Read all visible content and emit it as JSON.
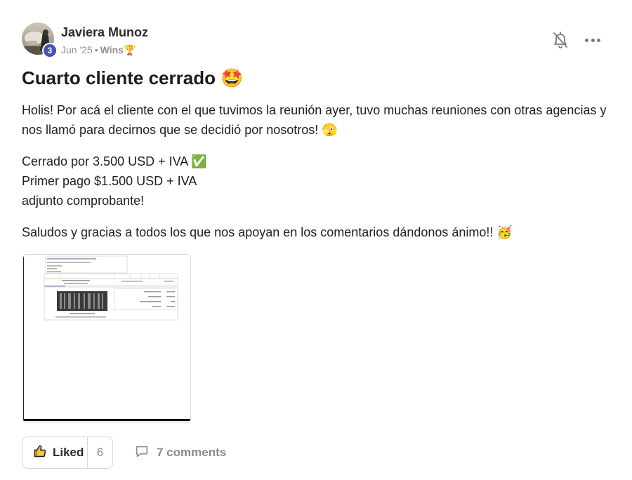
{
  "post": {
    "author": "Javiera Munoz",
    "level": "3",
    "date": "Jun '25",
    "separator": "•",
    "category": "Wins🏆",
    "title": "Cuarto cliente cerrado 🤩",
    "paragraphs": {
      "p1": "Holis! Por acá el cliente con el que tuvimos la reunión ayer, tuvo muchas reuniones con otras agencias y nos llamó para decirnos que se decidió por nosotros! 🫣",
      "p2_line1": "Cerrado por 3.500 USD + IVA ✅",
      "p2_line2": "Primer pago $1.500 USD + IVA",
      "p2_line3": "adjunto comprobante!",
      "p3": "Saludos y gracias a todos los que nos apoyan en los comentarios dándonos ánimo!! 🥳"
    }
  },
  "footer": {
    "like_label": "Liked",
    "like_count": "6",
    "comments_label": "7 comments"
  },
  "icons": {
    "notifications": "bell-off-icon",
    "more": "more-horizontal-icon",
    "like": "thumbs-up-icon",
    "comments": "comment-icon"
  },
  "colors": {
    "badge": "#4451b8",
    "muted": "#909090",
    "border": "#d8d8d8"
  }
}
